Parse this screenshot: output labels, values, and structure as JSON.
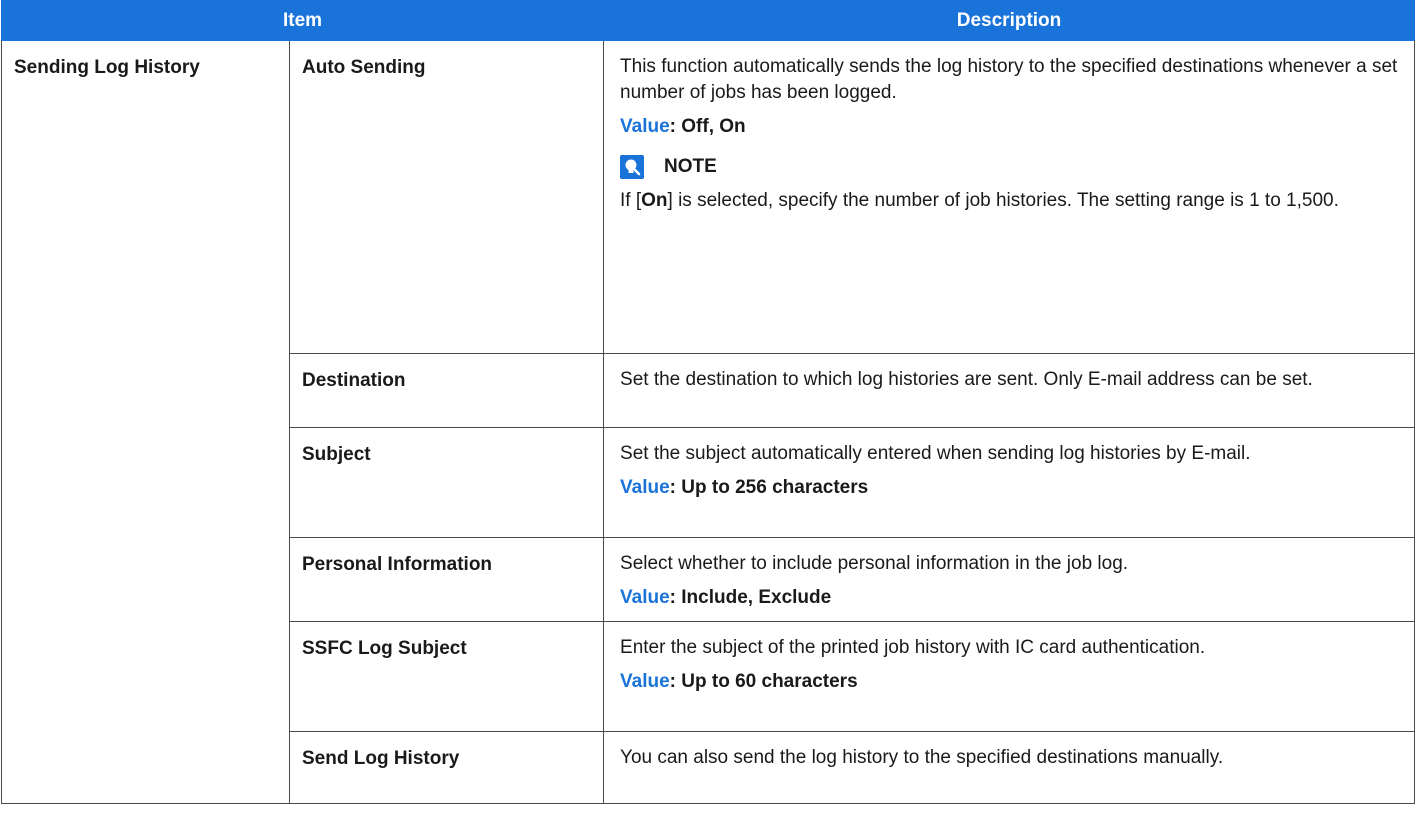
{
  "header": {
    "item": "Item",
    "description": "Description"
  },
  "group": "Sending Log History",
  "value_label": "Value",
  "rows": [
    {
      "item": "Auto Sending",
      "text": "This function automatically sends the log history to the specified destinations whenever a set number of jobs has been logged.",
      "value": ": Off, On",
      "note_title": "NOTE",
      "note_pre": "If [",
      "note_bold": "On",
      "note_post": "] is selected, specify the number of job histories. The setting range is 1 to 1,500."
    },
    {
      "item": "Destination",
      "text": "Set the destination to which log histories are sent. Only E-mail address can be set."
    },
    {
      "item": "Subject",
      "text": "Set the subject automatically entered when sending log histories by E-mail.",
      "value": ": Up to 256 characters"
    },
    {
      "item": "Personal Information",
      "text": "Select whether to include personal information in the job log.",
      "value": ": Include, Exclude"
    },
    {
      "item": "SSFC Log Subject",
      "text": "Enter the subject of the printed job history with IC card authentication.",
      "value": ": Up to 60 characters"
    },
    {
      "item": "Send Log History",
      "text": "You can also send the log history to the specified destinations manually."
    }
  ],
  "colors": {
    "header_bg": "#1a73d9",
    "value_label": "#1a73d9",
    "note_icon": "#1a73d9",
    "border": "#4a4a4a"
  },
  "icons": {
    "note": "note-lightbulb-icon"
  }
}
